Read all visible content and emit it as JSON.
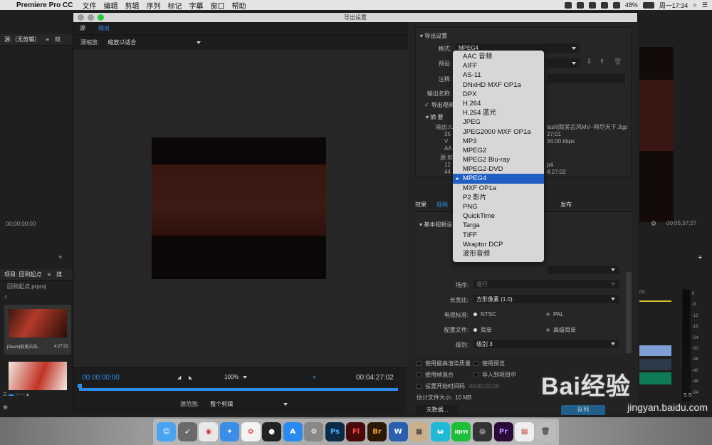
{
  "menubar": {
    "app": "Premiere Pro CC",
    "items": [
      "文件",
      "编辑",
      "剪辑",
      "序列",
      "标记",
      "字幕",
      "窗口",
      "帮助"
    ],
    "battery": "48%",
    "clock": "周一17:34"
  },
  "bg": {
    "source_tab": "源:（无剪辑）",
    "source_tab2": "效",
    "timecode_left": "00;00;00;00",
    "timecode_right": "00;05;37;27",
    "project_tab": "项目: 回到起点",
    "project_tab2": "媒",
    "project_file": "回到起点.prproj",
    "clip_name": "[Slash]取美古风...",
    "clip_duration": "4:27:02",
    "audio_db": [
      "0",
      "-6",
      "-12",
      "-18",
      "-24",
      "-30",
      "-36",
      "-42",
      "-48",
      "-54"
    ],
    "audio_ss": "S  S",
    "timeline_num": "00"
  },
  "dialog": {
    "title": "导出设置",
    "tabs": [
      "源",
      "输出"
    ],
    "source_scale_label": "源缩放:",
    "source_scale_value": "缩放以适合",
    "tc_start": "00:00:00:00",
    "tc_end": "00:04:27:02",
    "zoom": "100%",
    "range_label": "源范围:",
    "range_value": "整个剪辑",
    "export_settings_header": "导出设置",
    "format_label": "格式:",
    "format_value": "MPEG4",
    "preset_label": "预设:",
    "comment_label": "注释:",
    "output_name_label": "输出名称:",
    "export_video": "导出视频",
    "summary_header": "摘 要",
    "summary_out_label": "输出:/L",
    "summary_out_lines": [
      "lash]取美古风MV--倾尽天下.3gp",
      "27;01",
      "34.00 kbps"
    ],
    "summary_out_left": [
      "35",
      "V",
      "AA"
    ],
    "summary_src_label": "源:剪",
    "summary_src_lines": [
      "p4",
      "4:27:02"
    ],
    "summary_src_left": [
      "12",
      "44"
    ],
    "tabs2": [
      "效果",
      "视频",
      "发布"
    ],
    "basic_video": "基本视频设",
    "field_label": "场序:",
    "field_value": "逐行",
    "aspect_label": "长宽比:",
    "aspect_value": "方形像素 (1.0)",
    "tv_label": "电视标准:",
    "tv_ntsc": "NTSC",
    "tv_pal": "PAL",
    "profile_label": "配置文件:",
    "profile_simple": "简单",
    "profile_adv": "高级简单",
    "level_label": "级别:",
    "level_value": "级别 3",
    "opt_max_render": "使用最高渲染质量",
    "opt_preview": "使用预览",
    "opt_blend": "使用帧混合",
    "opt_import": "导入到项目中",
    "opt_start_tc": "设置开始时间码",
    "opt_start_tc_val": "00;00;00;00",
    "est_size_label": "估计文件大小:",
    "est_size_value": "10 MB",
    "metadata_btn": "元数据...",
    "queue_btn": "队列"
  },
  "format_menu": {
    "items": [
      "AAC 音频",
      "AIFF",
      "AS-11",
      "DNxHD MXF OP1a",
      "DPX",
      "H.264",
      "H.264 蓝光",
      "JPEG",
      "JPEG2000 MXF OP1a",
      "MP3",
      "MPEG2",
      "MPEG2 Blu-ray",
      "MPEG2-DVD",
      "MPEG4",
      "MXF OP1a",
      "P2 影片",
      "PNG",
      "QuickTime",
      "Targa",
      "TIFF",
      "Wraptor DCP",
      "波形音频"
    ],
    "selected": "MPEG4"
  },
  "dock": {
    "icons": [
      "finder-icon",
      "launchpad-icon",
      "chrome-icon",
      "safari-icon",
      "photos-icon",
      "qq-icon",
      "appstore-icon",
      "system-prefs-icon",
      "photoshop-icon",
      "flash-icon",
      "bridge-icon",
      "word-icon",
      "archive-icon",
      "wps-icon",
      "iqiyi-icon",
      "quicktime-icon",
      "premiere-icon",
      "preview-icon",
      "trash-icon"
    ],
    "labels": {
      "ps": "Ps",
      "fl": "Fl",
      "br": "Br",
      "w": "W",
      "iq": "iQIYI",
      "pr": "Pr"
    }
  },
  "watermark": {
    "text": "Bai经验",
    "url": "jingyan.baidu.com"
  }
}
